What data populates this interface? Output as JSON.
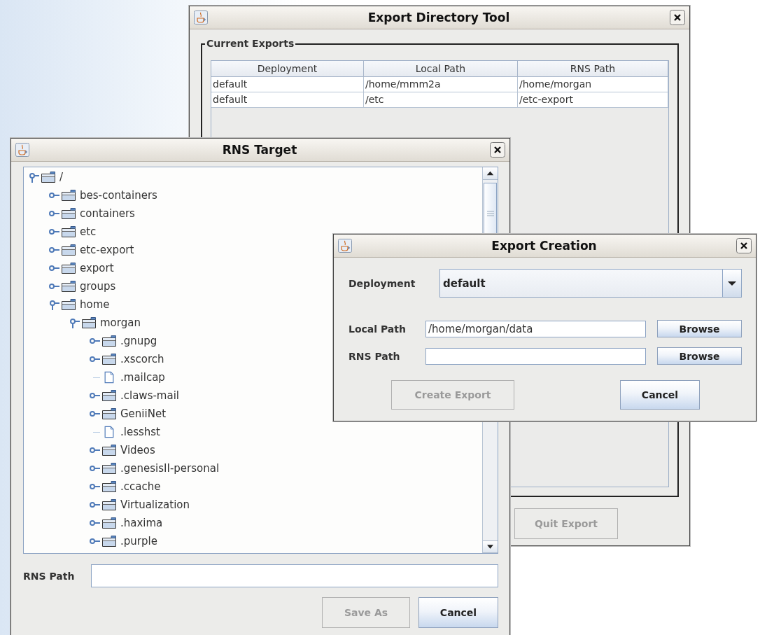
{
  "export_directory_tool": {
    "title": "Export Directory Tool",
    "group_title": "Current Exports",
    "table": {
      "columns": [
        "Deployment",
        "Local Path",
        "RNS Path"
      ],
      "rows": [
        [
          "default",
          "/home/mmm2a",
          "/home/morgan"
        ],
        [
          "default",
          "/etc",
          "/etc-export"
        ]
      ]
    },
    "buttons": [
      {
        "label": "Quit Export",
        "disabled": true
      }
    ]
  },
  "rns_target": {
    "title": "RNS Target",
    "tree": [
      {
        "label": "/",
        "kind": "folder",
        "expanded": true,
        "children": [
          {
            "label": "bes-containers",
            "kind": "folder",
            "expanded": false
          },
          {
            "label": "containers",
            "kind": "folder",
            "expanded": false
          },
          {
            "label": "etc",
            "kind": "folder",
            "expanded": false
          },
          {
            "label": "etc-export",
            "kind": "folder",
            "expanded": false
          },
          {
            "label": "export",
            "kind": "folder",
            "expanded": false
          },
          {
            "label": "groups",
            "kind": "folder",
            "expanded": false
          },
          {
            "label": "home",
            "kind": "folder",
            "expanded": true,
            "children": [
              {
                "label": "morgan",
                "kind": "folder",
                "expanded": true,
                "children": [
                  {
                    "label": ".gnupg",
                    "kind": "folder",
                    "expanded": false
                  },
                  {
                    "label": ".xscorch",
                    "kind": "folder",
                    "expanded": false
                  },
                  {
                    "label": ".mailcap",
                    "kind": "file"
                  },
                  {
                    "label": ".claws-mail",
                    "kind": "folder",
                    "expanded": false
                  },
                  {
                    "label": "GeniiNet",
                    "kind": "folder",
                    "expanded": false
                  },
                  {
                    "label": ".lesshst",
                    "kind": "file"
                  },
                  {
                    "label": "Videos",
                    "kind": "folder",
                    "expanded": false
                  },
                  {
                    "label": ".genesisII-personal",
                    "kind": "folder",
                    "expanded": false
                  },
                  {
                    "label": ".ccache",
                    "kind": "folder",
                    "expanded": false
                  },
                  {
                    "label": "Virtualization",
                    "kind": "folder",
                    "expanded": false
                  },
                  {
                    "label": ".haxima",
                    "kind": "folder",
                    "expanded": false
                  },
                  {
                    "label": ".purple",
                    "kind": "folder",
                    "expanded": false
                  }
                ]
              }
            ]
          }
        ]
      }
    ],
    "path_label": "RNS Path",
    "buttons": [
      {
        "label": "Save As",
        "disabled": true
      },
      {
        "label": "Cancel",
        "disabled": false
      }
    ]
  },
  "export_creation": {
    "title": "Export Creation",
    "deployment": {
      "label": "Deployment",
      "value": "default"
    },
    "local_path": {
      "label": "Local Path",
      "value": "/home/morgan/data",
      "button": "Browse"
    },
    "rns_path": {
      "label": "RNS Path",
      "button": "Browse"
    },
    "buttons": [
      {
        "label": "Create Export",
        "disabled": true
      },
      {
        "label": "Cancel",
        "disabled": false
      }
    ]
  }
}
